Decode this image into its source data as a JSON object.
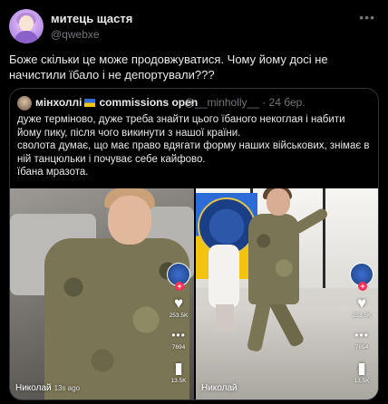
{
  "author": {
    "name": "митець щастя",
    "handle": "@qwebxe",
    "more_icon": "more-horizontal-icon"
  },
  "tweet_text": "Боже скільки це може продовжуватися. Чому йому досі не начистили їбало і не депортували???",
  "quoted": {
    "name": "мінхоллі",
    "flag_icon": "ukraine-flag-icon",
    "name_suffix": "commissions open",
    "handle": "@__minholly__",
    "date": "· 24 бер.",
    "lines": [
      "дуже терміново, дуже треба знайти цього їбаного некоглая і набити йому пику, після чого викинути з нашої країни.",
      "сволота думає, що має право вдягати форму наших військових, знімає в ній танцюльки і почуває себе кайфово.",
      "їбана мразота."
    ],
    "media": [
      {
        "side": {
          "likes": "253.5K",
          "comments": "7694",
          "saves": "13.5K"
        },
        "username": "Николай",
        "tag": "13s ago"
      },
      {
        "side": {
          "likes": "253.5K",
          "comments": "7694",
          "saves": "13.5K"
        },
        "username": "Николай",
        "tag": ""
      }
    ]
  },
  "icons": {
    "like": "heart-icon",
    "comment": "comment-bubble-icon",
    "more": "dots-icon",
    "save": "bookmark-icon"
  },
  "colors": {
    "background": "#000000",
    "text": "#e7e9ea",
    "secondary": "#71767b",
    "border": "#2f3336",
    "tiktok_red": "#fe2c55"
  }
}
